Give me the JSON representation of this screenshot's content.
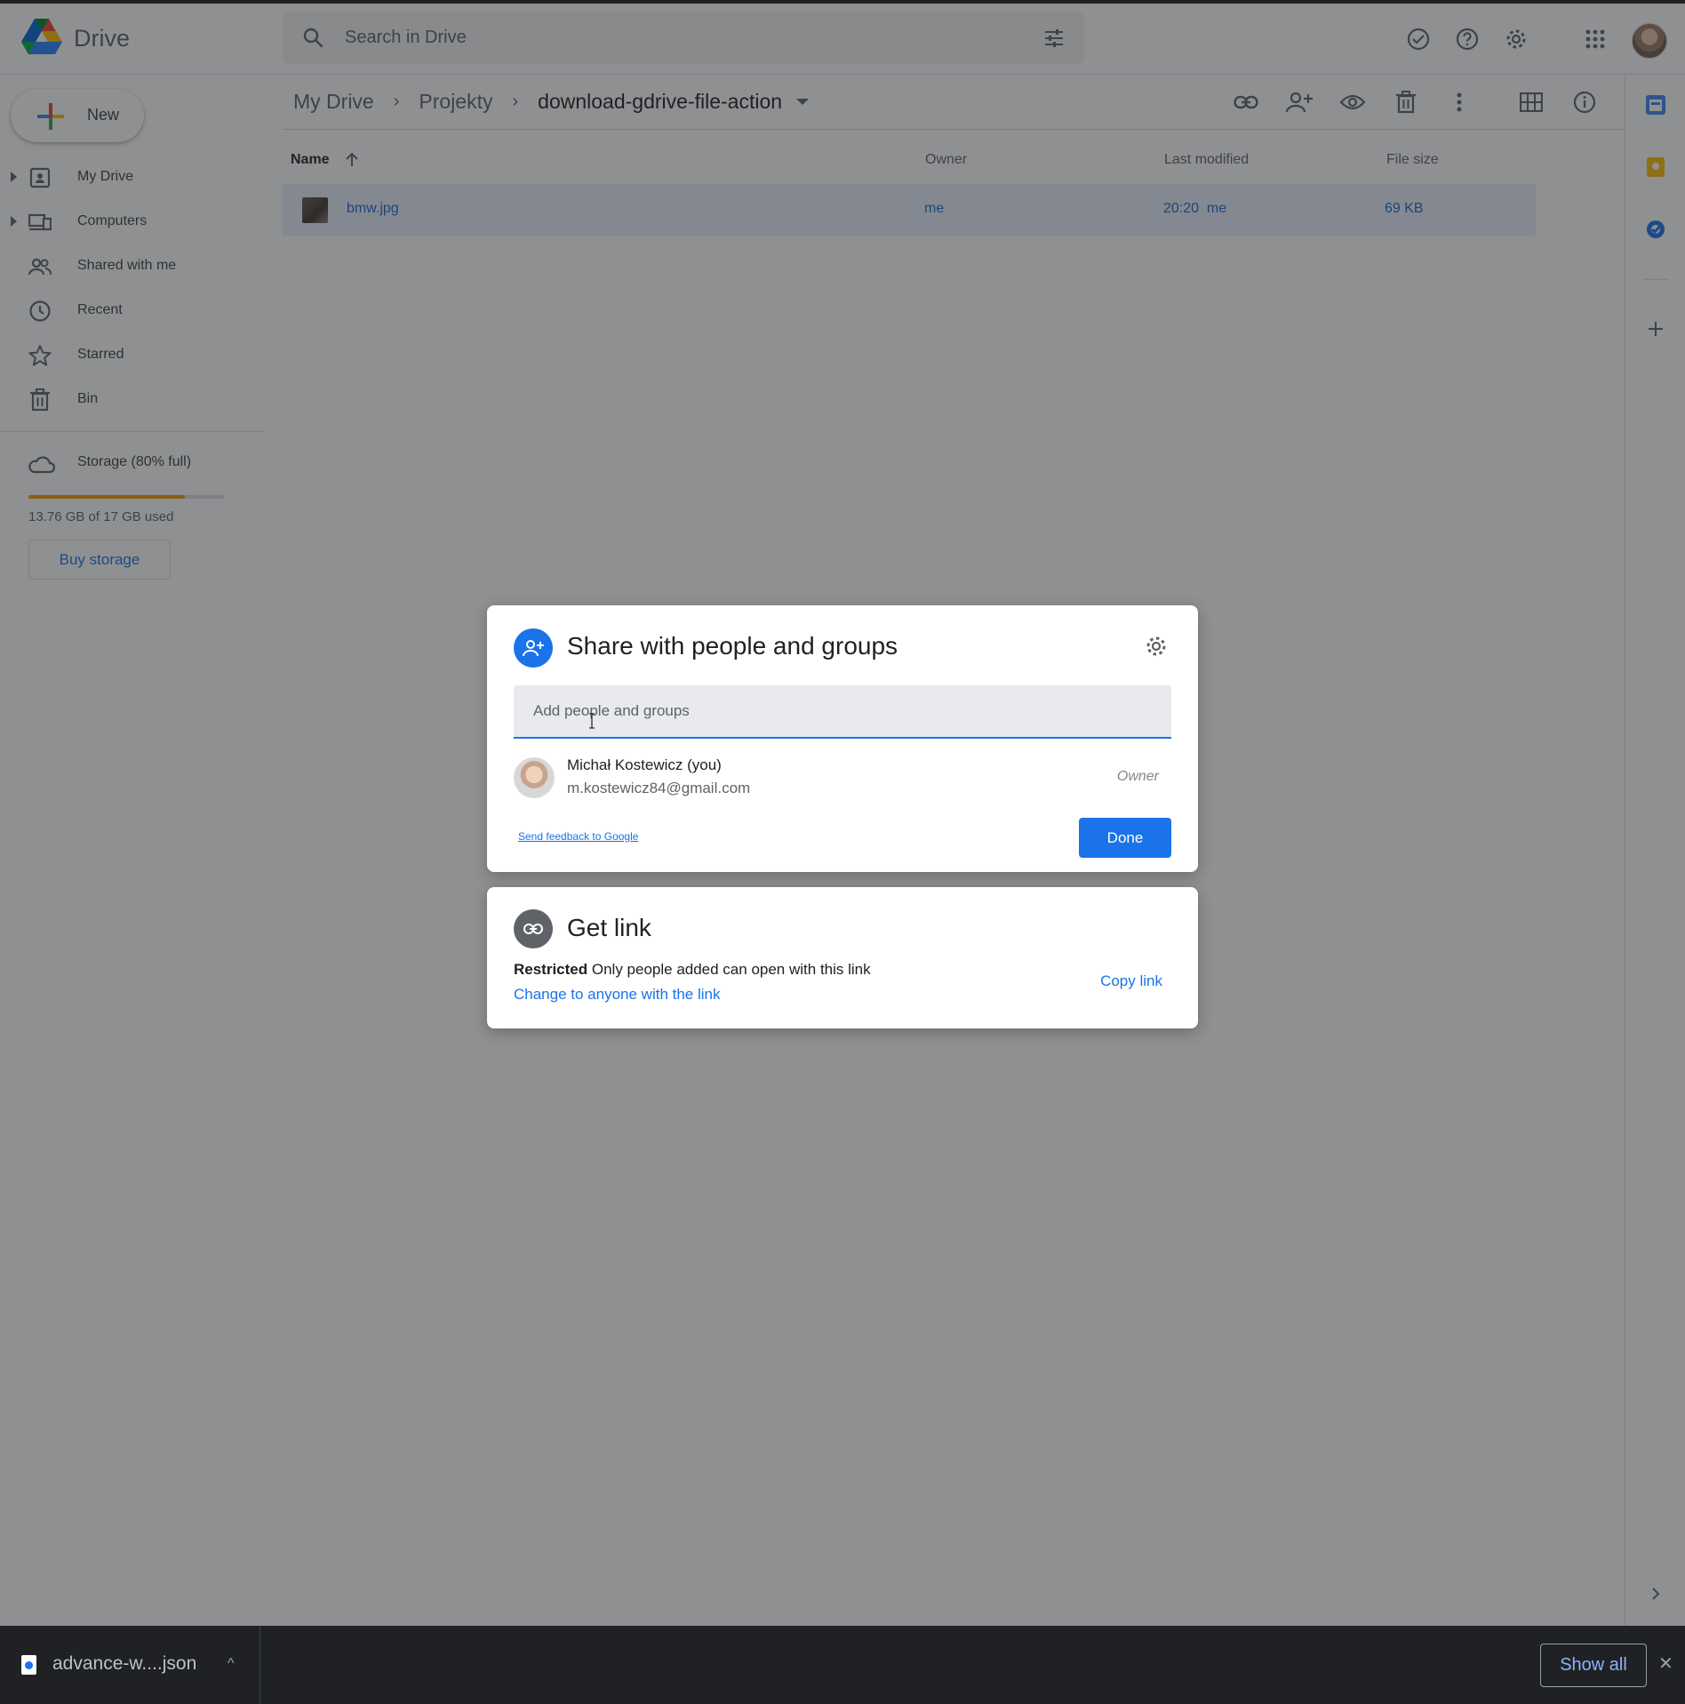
{
  "app": {
    "title": "Drive"
  },
  "search": {
    "placeholder": "Search in Drive"
  },
  "sidebar": {
    "new_label": "New",
    "items": [
      {
        "label": "My Drive"
      },
      {
        "label": "Computers"
      },
      {
        "label": "Shared with me"
      },
      {
        "label": "Recent"
      },
      {
        "label": "Starred"
      },
      {
        "label": "Bin"
      }
    ],
    "storage": {
      "label": "Storage (80% full)",
      "percent_used": 80,
      "used_text": "13.76 GB of 17 GB used",
      "buy_label": "Buy storage"
    }
  },
  "breadcrumb": {
    "items": [
      "My Drive",
      "Projekty",
      "download-gdrive-file-action"
    ]
  },
  "table": {
    "columns": [
      "Name",
      "Owner",
      "Last modified",
      "File size"
    ],
    "rows": [
      {
        "name": "bmw.jpg",
        "owner": "me",
        "modified": "20:20  me",
        "size": "69 KB"
      }
    ]
  },
  "share_dialog": {
    "title": "Share with people and groups",
    "input_placeholder": "Add people and groups",
    "person": {
      "name": "Michał Kostewicz (you)",
      "email": "m.kostewicz84@gmail.com",
      "role": "Owner"
    },
    "feedback_label": "Send feedback to Google",
    "done_label": "Done"
  },
  "link_dialog": {
    "title": "Get link",
    "restricted_label": "Restricted",
    "restricted_desc": " Only people added can open with this link",
    "change_label": "Change to anyone with the link",
    "copy_label": "Copy link"
  },
  "download_bar": {
    "file_name": "advance-w....json",
    "show_all_label": "Show all",
    "close_glyph": "✕",
    "chevron_glyph": "^"
  },
  "colors": {
    "accent": "#1a73e8",
    "selected_row": "#e8f0fe",
    "storage_fill": "#f29900",
    "download_bar": "#202124"
  }
}
